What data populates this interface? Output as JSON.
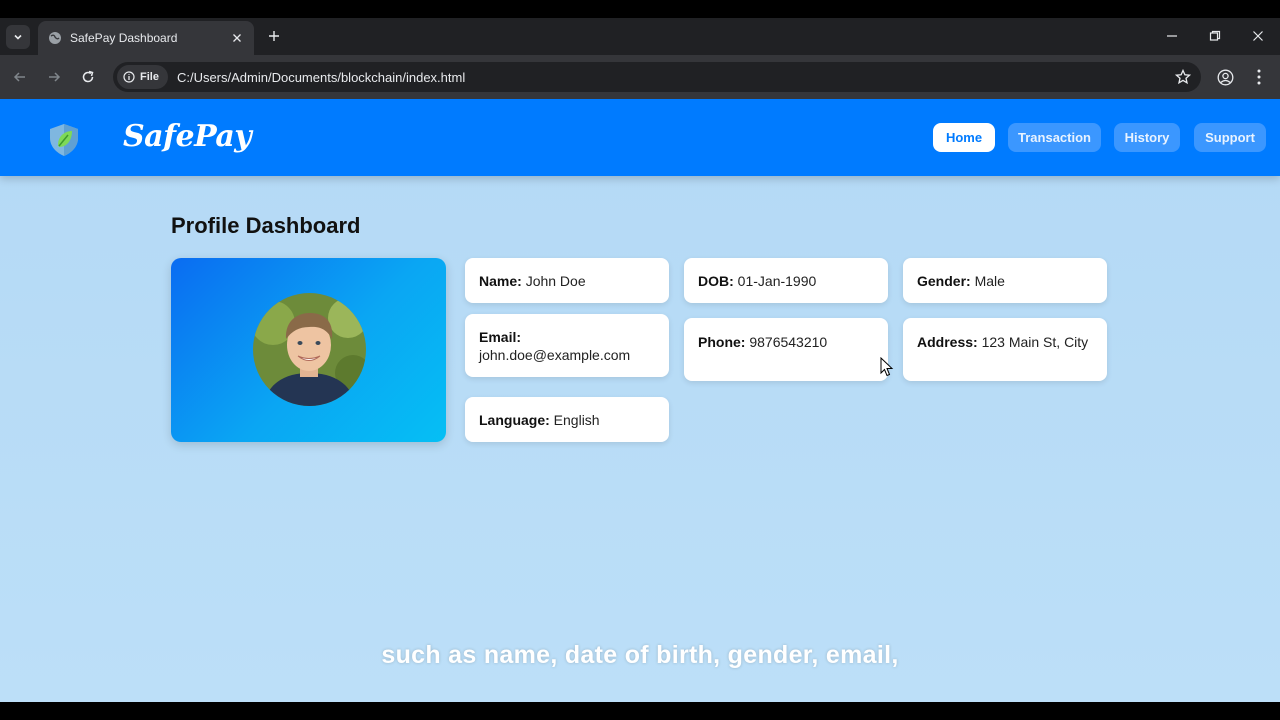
{
  "browser": {
    "tab_title": "SafePay Dashboard",
    "scheme_chip": "File",
    "url": "C:/Users/Admin/Documents/blockchain/index.html"
  },
  "header": {
    "brand": "SafePay",
    "nav": [
      {
        "label": "Home",
        "active": true
      },
      {
        "label": "Transaction",
        "active": false
      },
      {
        "label": "History",
        "active": false
      },
      {
        "label": "Support",
        "active": false
      }
    ]
  },
  "main": {
    "title": "Profile Dashboard",
    "fields": {
      "name": {
        "label": "Name:",
        "value": "John Doe"
      },
      "dob": {
        "label": "DOB:",
        "value": "01-Jan-1990"
      },
      "gender": {
        "label": "Gender:",
        "value": "Male"
      },
      "email": {
        "label": "Email:",
        "value": "john.doe@example.com"
      },
      "phone": {
        "label": "Phone:",
        "value": "9876543210"
      },
      "address": {
        "label": "Address:",
        "value": "123 Main St, City"
      },
      "language": {
        "label": "Language:",
        "value": "English"
      }
    }
  },
  "caption": "such as name, date of birth, gender, email,",
  "colors": {
    "header_blue": "#007bff",
    "page_bg": "#b4d9f5",
    "card_gradient_start": "#0a6cf2",
    "card_gradient_end": "#05bff4"
  },
  "icons": [
    "tab-list-icon",
    "globe-favicon-icon",
    "close-tab-icon",
    "new-tab-icon",
    "minimize-icon",
    "restore-icon",
    "close-window-icon",
    "back-icon",
    "forward-icon",
    "reload-icon",
    "info-icon",
    "bookmark-star-icon",
    "profile-icon",
    "menu-icon",
    "shield-logo-icon",
    "mouse-cursor-icon"
  ]
}
